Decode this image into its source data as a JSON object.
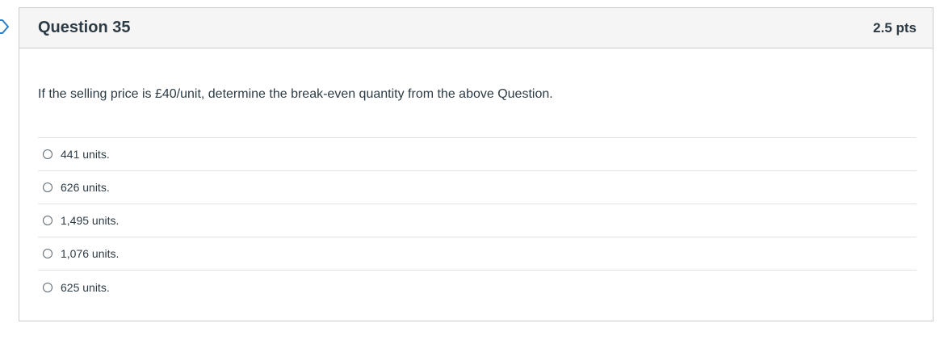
{
  "question": {
    "title": "Question 35",
    "points": "2.5 pts",
    "text": "If the selling price is £40/unit, determine the break-even quantity from the above Question.",
    "answers": [
      {
        "label": "441 units."
      },
      {
        "label": "626 units."
      },
      {
        "label": "1,495 units."
      },
      {
        "label": "1,076 units."
      },
      {
        "label": "625 units."
      }
    ]
  },
  "icons": {
    "flag": "bookmark-flag-icon",
    "radio": "radio-button"
  },
  "colors": {
    "text": "#2d3b45",
    "border": "#c7cdd1",
    "header_bg": "#f5f5f5",
    "divider": "#dfe3e6"
  }
}
